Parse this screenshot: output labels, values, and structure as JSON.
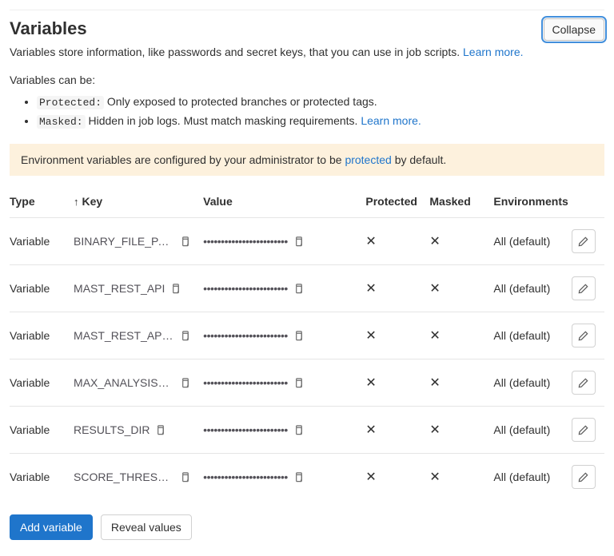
{
  "header": {
    "title": "Variables",
    "collapse_label": "Collapse"
  },
  "intro": {
    "text": "Variables store information, like passwords and secret keys, that you can use in job scripts. ",
    "learn_more": "Learn more."
  },
  "can_be_text": "Variables can be:",
  "defs": {
    "protected_kw": "Protected:",
    "protected_text": " Only exposed to protected branches or protected tags.",
    "masked_kw": "Masked:",
    "masked_text": " Hidden in job logs. Must match masking requirements. ",
    "masked_learn_more": "Learn more."
  },
  "admin_note": {
    "prefix": "Environment variables are configured by your administrator to be ",
    "link": "protected",
    "suffix": " by default."
  },
  "columns": {
    "type": "Type",
    "key": "Key",
    "value": "Value",
    "protected": "Protected",
    "masked": "Masked",
    "environments": "Environments"
  },
  "sort_indicator": "↑",
  "masked_value": "••••••••••••••••••••••••",
  "rows": [
    {
      "type": "Variable",
      "key": "BINARY_FILE_PATH",
      "protected": false,
      "masked": false,
      "env": "All (default)"
    },
    {
      "type": "Variable",
      "key": "MAST_REST_API",
      "protected": false,
      "masked": false,
      "env": "All (default)"
    },
    {
      "type": "Variable",
      "key": "MAST_REST_API_KEY",
      "protected": false,
      "masked": false,
      "env": "All (default)"
    },
    {
      "type": "Variable",
      "key": "MAX_ANALYSIS_TIME",
      "protected": false,
      "masked": false,
      "env": "All (default)"
    },
    {
      "type": "Variable",
      "key": "RESULTS_DIR",
      "protected": false,
      "masked": false,
      "env": "All (default)"
    },
    {
      "type": "Variable",
      "key": "SCORE_THRESHOLD_C…",
      "protected": false,
      "masked": false,
      "env": "All (default)"
    }
  ],
  "buttons": {
    "add_variable": "Add variable",
    "reveal_values": "Reveal values"
  }
}
